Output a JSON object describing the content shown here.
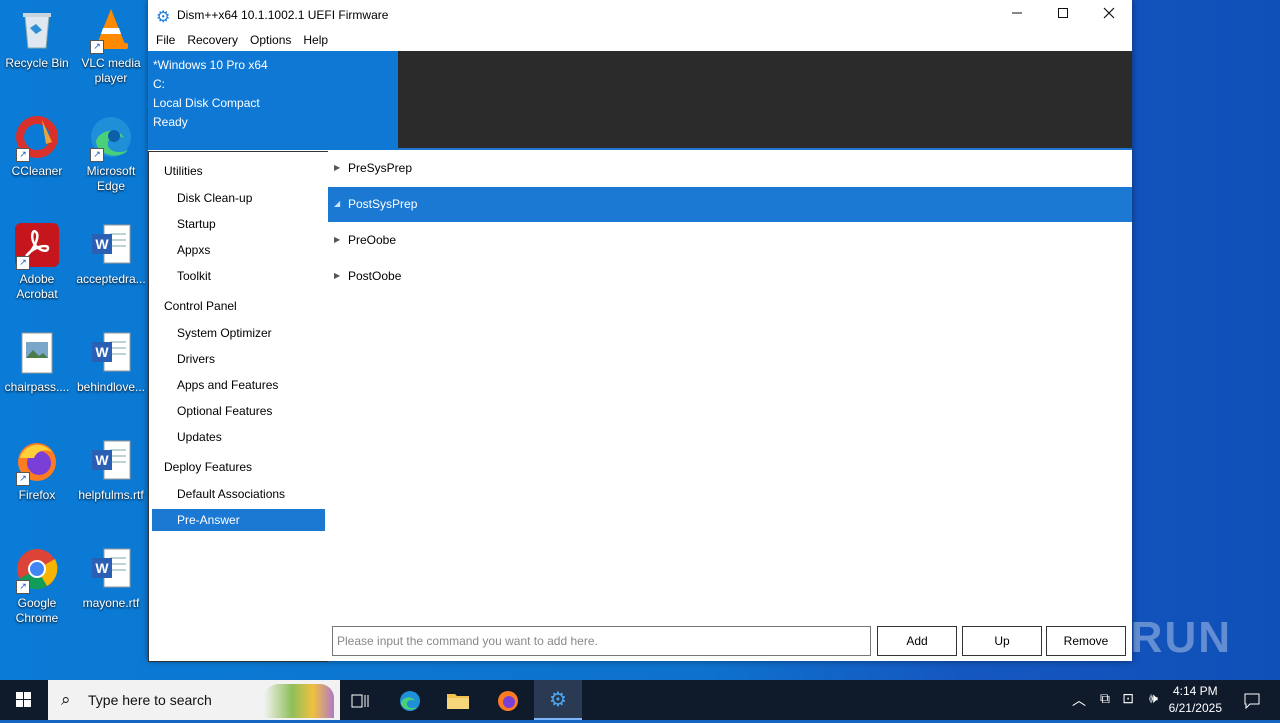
{
  "desktop_icons": [
    {
      "label": "Recycle Bin",
      "icon": "recycle-bin-icon"
    },
    {
      "label": "VLC media player",
      "icon": "vlc-icon"
    },
    {
      "label": "CCleaner",
      "icon": "ccleaner-icon"
    },
    {
      "label": "Microsoft Edge",
      "icon": "edge-icon"
    },
    {
      "label": "Adobe Acrobat",
      "icon": "acrobat-icon"
    },
    {
      "label": "acceptedra...",
      "icon": "word-doc-icon"
    },
    {
      "label": "chairpass....",
      "icon": "image-file-icon"
    },
    {
      "label": "behindlove...",
      "icon": "word-doc-icon"
    },
    {
      "label": "Firefox",
      "icon": "firefox-icon"
    },
    {
      "label": "helpfulms.rtf",
      "icon": "word-doc-icon"
    },
    {
      "label": "Google Chrome",
      "icon": "chrome-icon"
    },
    {
      "label": "mayone.rtf",
      "icon": "word-doc-icon"
    }
  ],
  "window": {
    "title": "Dism++x64 10.1.1002.1 UEFI Firmware",
    "menu": [
      "File",
      "Recovery",
      "Options",
      "Help"
    ],
    "info": [
      "*Windows 10 Pro x64",
      "C:",
      "Local Disk Compact",
      "Ready"
    ],
    "sidebar": {
      "groups": [
        {
          "label": "Utilities",
          "items": [
            "Disk Clean-up",
            "Startup",
            "Appxs",
            "Toolkit"
          ]
        },
        {
          "label": "Control Panel",
          "items": [
            "System Optimizer",
            "Drivers",
            "Apps and Features",
            "Optional Features",
            "Updates"
          ]
        },
        {
          "label": "Deploy Features",
          "items": [
            "Default Associations",
            "Pre-Answer"
          ]
        }
      ],
      "selected": "Pre-Answer"
    },
    "tree": [
      {
        "label": "PreSysPrep",
        "expanded": false,
        "selected": false
      },
      {
        "label": "PostSysPrep",
        "expanded": true,
        "selected": true
      },
      {
        "label": "PreOobe",
        "expanded": false,
        "selected": false
      },
      {
        "label": "PostOobe",
        "expanded": false,
        "selected": false
      }
    ],
    "command": {
      "placeholder": "Please input the command you want to add here.",
      "value": "",
      "add_label": "Add",
      "up_label": "Up",
      "remove_label": "Remove"
    }
  },
  "watermark": "ANY RUN",
  "taskbar": {
    "search_placeholder": "Type here to search",
    "time": "4:14 PM",
    "date": "6/21/2025"
  }
}
